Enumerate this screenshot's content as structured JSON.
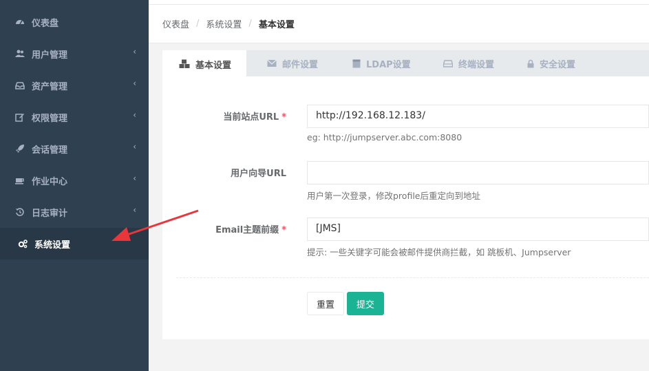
{
  "sidebar": {
    "items": [
      {
        "label": "仪表盘",
        "icon": "dashboard-icon",
        "has_children": false
      },
      {
        "label": "用户管理",
        "icon": "users-icon",
        "has_children": true
      },
      {
        "label": "资产管理",
        "icon": "inbox-icon",
        "has_children": true
      },
      {
        "label": "权限管理",
        "icon": "edit-icon",
        "has_children": true
      },
      {
        "label": "会话管理",
        "icon": "rocket-icon",
        "has_children": true
      },
      {
        "label": "作业中心",
        "icon": "coffee-icon",
        "has_children": true
      },
      {
        "label": "日志审计",
        "icon": "history-icon",
        "has_children": true
      },
      {
        "label": "系统设置",
        "icon": "cogs-icon",
        "has_children": false,
        "active": true
      }
    ],
    "chevron": "‹"
  },
  "breadcrumb": {
    "items": [
      "仪表盘",
      "系统设置",
      "基本设置"
    ],
    "separator": "/"
  },
  "tabs": [
    {
      "label": "基本设置",
      "icon": "cubes-icon",
      "active": true
    },
    {
      "label": "邮件设置",
      "icon": "envelope-icon"
    },
    {
      "label": "LDAP设置",
      "icon": "database-icon"
    },
    {
      "label": "终端设置",
      "icon": "hdd-icon"
    },
    {
      "label": "安全设置",
      "icon": "lock-icon"
    }
  ],
  "form": {
    "site_url": {
      "label": "当前站点URL",
      "required": "*",
      "value": "http://192.168.12.183/",
      "help": "eg: http://jumpserver.abc.com:8080"
    },
    "user_guide_url": {
      "label": "用户向导URL",
      "value": "",
      "help": "用户第一次登录，修改profile后重定向到地址"
    },
    "email_prefix": {
      "label": "Email主题前缀",
      "required": "*",
      "value": "[JMS]",
      "help": "提示: 一些关键字可能会被邮件提供商拦截，如 跳板机、Jumpserver"
    },
    "reset_label": "重置",
    "submit_label": "提交"
  },
  "colors": {
    "sidebar_bg": "#2f4050",
    "sidebar_active_bg": "#293846",
    "primary": "#1ab394",
    "required": "#ed5565",
    "annotation_arrow": "#e8363a"
  }
}
